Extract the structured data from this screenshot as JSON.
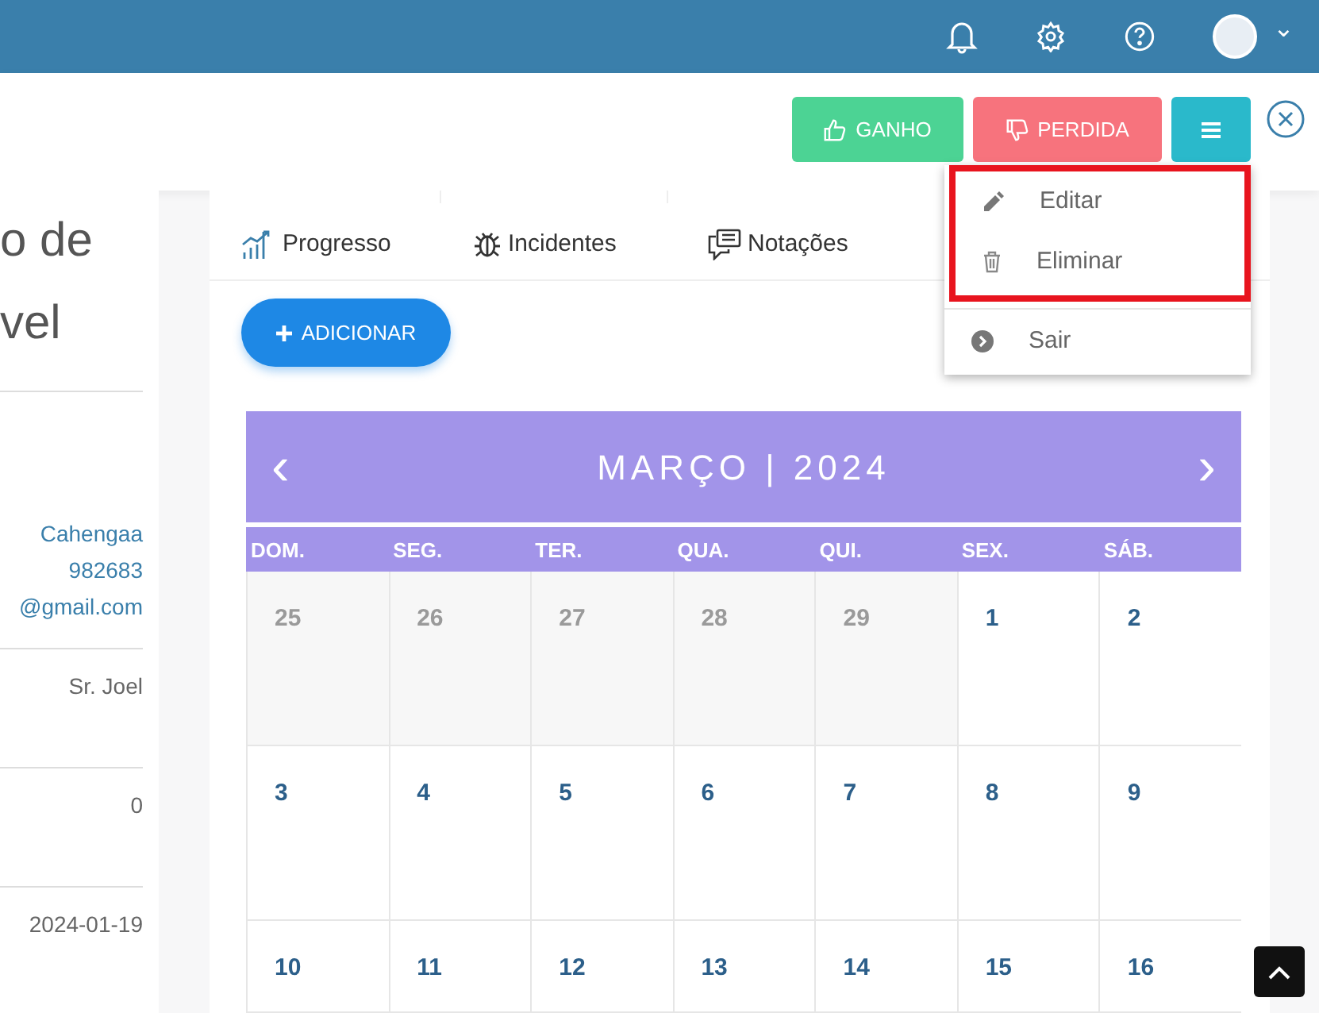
{
  "topbar": {
    "menu_caret": "⌄"
  },
  "actions": [
    {
      "kind": "won",
      "label": "GANHO"
    },
    {
      "kind": "lost",
      "label": "PERDIDA"
    },
    {
      "kind": "menu"
    }
  ],
  "menu": {
    "items": [
      {
        "kind": "edit",
        "label": "Editar",
        "highlighted": true
      },
      {
        "kind": "delete",
        "label": "Eliminar",
        "highlighted": true
      },
      {
        "kind": "exit",
        "label": "Sair",
        "highlighted": false
      }
    ]
  },
  "left_panel": {
    "title_lines": [
      "o de",
      "vel"
    ],
    "contact_lines": [
      "Cahengaa",
      "982683",
      "@gmail.com"
    ],
    "fields": [
      "Sr. Joel",
      "0",
      "2024-01-19"
    ]
  },
  "tabs": [
    {
      "kind": "progress",
      "label": "Progresso"
    },
    {
      "kind": "incidents",
      "label": "Incidentes"
    },
    {
      "kind": "notes",
      "label": "Notações"
    }
  ],
  "add_button": {
    "label": "ADICIONAR"
  },
  "calendar": {
    "prev": "‹",
    "title": "MARÇO | 2024",
    "next": "›",
    "weekdays": [
      "DOM.",
      "SEG.",
      "TER.",
      "QUA.",
      "QUI.",
      "SEX.",
      "SÁB."
    ],
    "weeks": [
      [
        {
          "day": "25",
          "outside": true
        },
        {
          "day": "26",
          "outside": true
        },
        {
          "day": "27",
          "outside": true
        },
        {
          "day": "28",
          "outside": true
        },
        {
          "day": "29",
          "outside": true
        },
        {
          "day": "1",
          "outside": false
        },
        {
          "day": "2",
          "outside": false
        }
      ],
      [
        {
          "day": "3",
          "outside": false
        },
        {
          "day": "4",
          "outside": false
        },
        {
          "day": "5",
          "outside": false
        },
        {
          "day": "6",
          "outside": false
        },
        {
          "day": "7",
          "outside": false
        },
        {
          "day": "8",
          "outside": false
        },
        {
          "day": "9",
          "outside": false
        }
      ],
      [
        {
          "day": "10",
          "outside": false
        },
        {
          "day": "11",
          "outside": false
        },
        {
          "day": "12",
          "outside": false
        },
        {
          "day": "13",
          "outside": false
        },
        {
          "day": "14",
          "outside": false
        },
        {
          "day": "15",
          "outside": false
        },
        {
          "day": "16",
          "outside": false
        }
      ]
    ]
  }
}
